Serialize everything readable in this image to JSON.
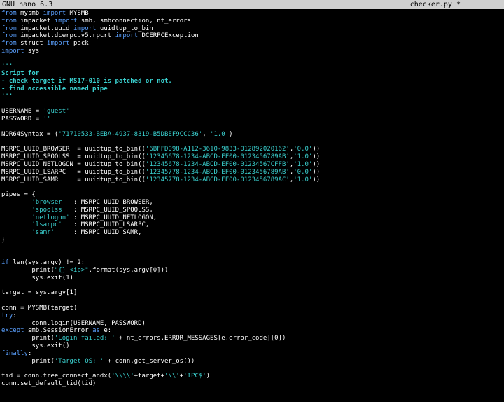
{
  "titlebar": {
    "app": "GNU nano 6.3",
    "file": "checker.py *"
  },
  "colors": {
    "background": "#000000",
    "titlebar": "#d0d0d0",
    "keyword": "#5aa0ff",
    "string": "#3ad0cf",
    "text": "#ffffff"
  },
  "code": [
    [
      [
        "kw",
        "from"
      ],
      [
        "t",
        " mysmb "
      ],
      [
        "kw",
        "import"
      ],
      [
        "t",
        " MYSMB"
      ]
    ],
    [
      [
        "kw",
        "from"
      ],
      [
        "t",
        " impacket "
      ],
      [
        "kw",
        "import"
      ],
      [
        "t",
        " smb, smbconnection, nt_errors"
      ]
    ],
    [
      [
        "kw",
        "from"
      ],
      [
        "t",
        " impacket.uuid "
      ],
      [
        "kw",
        "import"
      ],
      [
        "t",
        " uuidtup_to_bin"
      ]
    ],
    [
      [
        "kw",
        "from"
      ],
      [
        "t",
        " impacket.dcerpc.v5.rpcrt "
      ],
      [
        "kw",
        "import"
      ],
      [
        "t",
        " DCERPCException"
      ]
    ],
    [
      [
        "kw",
        "from"
      ],
      [
        "t",
        " struct "
      ],
      [
        "kw",
        "import"
      ],
      [
        "t",
        " pack"
      ]
    ],
    [
      [
        "kw",
        "import"
      ],
      [
        "t",
        " sys"
      ]
    ],
    [],
    [
      [
        "c",
        "'''"
      ]
    ],
    [
      [
        "c",
        "Script for"
      ]
    ],
    [
      [
        "c",
        "- check target if MS17-010 is patched or not."
      ]
    ],
    [
      [
        "c",
        "- find accessible named pipe"
      ]
    ],
    [
      [
        "c",
        "'''"
      ]
    ],
    [],
    [
      [
        "t",
        "USERNAME = "
      ],
      [
        "s",
        "'guest'"
      ]
    ],
    [
      [
        "t",
        "PASSWORD = "
      ],
      [
        "s",
        "''"
      ]
    ],
    [],
    [
      [
        "t",
        "NDR64Syntax = ("
      ],
      [
        "s",
        "'71710533-BEBA-4937-8319-B5DBEF9CCC36'"
      ],
      [
        "t",
        ", "
      ],
      [
        "s",
        "'1.0'"
      ],
      [
        "t",
        ")"
      ]
    ],
    [],
    [
      [
        "t",
        "MSRPC_UUID_BROWSER  = uuidtup_to_bin(("
      ],
      [
        "s",
        "'6BFFD098-A112-3610-9833-012892020162'"
      ],
      [
        "t",
        ","
      ],
      [
        "s",
        "'0.0'"
      ],
      [
        "t",
        "))"
      ]
    ],
    [
      [
        "t",
        "MSRPC_UUID_SPOOLSS  = uuidtup_to_bin(("
      ],
      [
        "s",
        "'12345678-1234-ABCD-EF00-0123456789AB'"
      ],
      [
        "t",
        ","
      ],
      [
        "s",
        "'1.0'"
      ],
      [
        "t",
        "))"
      ]
    ],
    [
      [
        "t",
        "MSRPC_UUID_NETLOGON = uuidtup_to_bin(("
      ],
      [
        "s",
        "'12345678-1234-ABCD-EF00-01234567CFFB'"
      ],
      [
        "t",
        ","
      ],
      [
        "s",
        "'1.0'"
      ],
      [
        "t",
        "))"
      ]
    ],
    [
      [
        "t",
        "MSRPC_UUID_LSARPC   = uuidtup_to_bin(("
      ],
      [
        "s",
        "'12345778-1234-ABCD-EF00-0123456789AB'"
      ],
      [
        "t",
        ","
      ],
      [
        "s",
        "'0.0'"
      ],
      [
        "t",
        "))"
      ]
    ],
    [
      [
        "t",
        "MSRPC_UUID_SAMR     = uuidtup_to_bin(("
      ],
      [
        "s",
        "'12345778-1234-ABCD-EF00-0123456789AC'"
      ],
      [
        "t",
        ","
      ],
      [
        "s",
        "'1.0'"
      ],
      [
        "t",
        "))"
      ]
    ],
    [],
    [
      [
        "t",
        "pipes = {"
      ]
    ],
    [
      [
        "t",
        "        "
      ],
      [
        "s",
        "'browser'"
      ],
      [
        "t",
        "  : MSRPC_UUID_BROWSER,"
      ]
    ],
    [
      [
        "t",
        "        "
      ],
      [
        "s",
        "'spoolss'"
      ],
      [
        "t",
        "  : MSRPC_UUID_SPOOLSS,"
      ]
    ],
    [
      [
        "t",
        "        "
      ],
      [
        "s",
        "'netlogon'"
      ],
      [
        "t",
        " : MSRPC_UUID_NETLOGON,"
      ]
    ],
    [
      [
        "t",
        "        "
      ],
      [
        "s",
        "'lsarpc'"
      ],
      [
        "t",
        "   : MSRPC_UUID_LSARPC,"
      ]
    ],
    [
      [
        "t",
        "        "
      ],
      [
        "s",
        "'samr'"
      ],
      [
        "t",
        "     : MSRPC_UUID_SAMR,"
      ]
    ],
    [
      [
        "t",
        "}"
      ]
    ],
    [],
    [],
    [
      [
        "kw",
        "if"
      ],
      [
        "t",
        " len(sys.argv) != 2:"
      ]
    ],
    [
      [
        "t",
        "        print("
      ],
      [
        "s",
        "\"{} <ip>\""
      ],
      [
        "t",
        ".format(sys.argv[0]))"
      ]
    ],
    [
      [
        "t",
        "        sys.exit(1)"
      ]
    ],
    [],
    [
      [
        "t",
        "target = sys.argv[1]"
      ]
    ],
    [],
    [
      [
        "t",
        "conn = MYSMB(target)"
      ]
    ],
    [
      [
        "kw",
        "try"
      ],
      [
        "t",
        ":"
      ]
    ],
    [
      [
        "t",
        "        conn.login(USERNAME, PASSWORD)"
      ]
    ],
    [
      [
        "kw",
        "except"
      ],
      [
        "t",
        " smb.SessionError "
      ],
      [
        "kw",
        "as"
      ],
      [
        "t",
        " e:"
      ]
    ],
    [
      [
        "t",
        "        print("
      ],
      [
        "s",
        "'Login failed: '"
      ],
      [
        "t",
        " + nt_errors.ERROR_MESSAGES[e.error_code][0])"
      ]
    ],
    [
      [
        "t",
        "        sys.exit()"
      ]
    ],
    [
      [
        "kw",
        "finally"
      ],
      [
        "t",
        ":"
      ]
    ],
    [
      [
        "t",
        "        print("
      ],
      [
        "s",
        "'Target OS: '"
      ],
      [
        "t",
        " + conn.get_server_os())"
      ]
    ],
    [],
    [
      [
        "t",
        "tid = conn.tree_connect_andx("
      ],
      [
        "s",
        "'\\\\\\\\'"
      ],
      [
        "t",
        "+target+"
      ],
      [
        "s",
        "'\\\\'"
      ],
      [
        "t",
        "+"
      ],
      [
        "s",
        "'IPC$'"
      ],
      [
        "t",
        ")"
      ]
    ],
    [
      [
        "t",
        "conn.set_default_tid(tid)"
      ]
    ]
  ]
}
